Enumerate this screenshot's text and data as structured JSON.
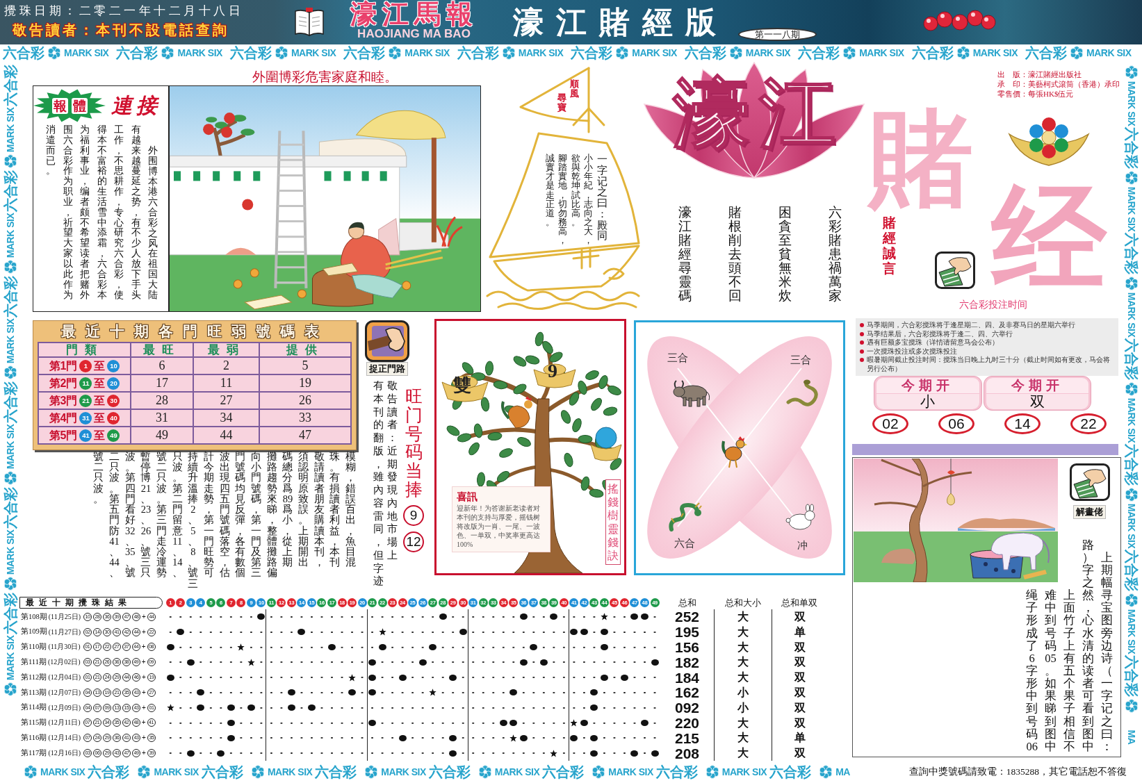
{
  "header": {
    "draw_date": "攪珠日期：二零二一年十二月十八日",
    "notice": "敬告讀者：本刊不設電話查詢",
    "paper_name": "濠江馬報",
    "paper_name_latin": "HAOJIANG MA BAO",
    "edition": "濠江賭經版",
    "issue": "第一一八期"
  },
  "ribbons": {
    "top": [
      {
        "cn": "六合彩",
        "en": "MARK SIX"
      },
      {
        "cn": "六合彩",
        "en": "MARK SIX"
      },
      {
        "cn": "六合彩",
        "en": "MARK SIX"
      },
      {
        "cn": "六合彩",
        "en": "MARK SIX"
      },
      {
        "cn": "六合彩",
        "en": "MARK SIX"
      },
      {
        "cn": "六合彩",
        "en": "MARK SIX"
      },
      {
        "cn": "六合彩",
        "en": "MARK SIX"
      },
      {
        "cn": "六合彩",
        "en": "MARK SIX"
      },
      {
        "cn": "六合彩",
        "en": "MARK SIX"
      },
      {
        "cn": "六合彩",
        "en": "MARK SIX"
      }
    ],
    "left": [
      {
        "cn": "六合彩",
        "en": "MARK SIX"
      },
      {
        "cn": "六合彩",
        "en": "MARK SIX"
      },
      {
        "cn": "六合彩",
        "en": "MARK SIX"
      },
      {
        "cn": "六合彩",
        "en": "MARK SIX"
      },
      {
        "cn": "六合彩",
        "en": "MARK SIX"
      },
      {
        "cn": "六合彩",
        "en": "MARK SIX"
      }
    ],
    "right": [
      {
        "cn": "六合彩",
        "en": "MARK SIX"
      },
      {
        "cn": "六合彩",
        "en": "MARK SIX"
      },
      {
        "cn": "六合彩",
        "en": "MARK SIX"
      },
      {
        "cn": "六合彩",
        "en": "MARK SIX"
      },
      {
        "cn": "六合彩",
        "en": "MARK SIX"
      },
      {
        "cn": "六合彩",
        "en": "MARK SIX"
      },
      {
        "en": "MA"
      }
    ],
    "bottom": [
      {
        "cn": "六合彩",
        "en": "MARK SIX"
      },
      {
        "cn": "六合彩",
        "en": "MARK SIX"
      },
      {
        "cn": "六合彩",
        "en": "MARK SIX"
      },
      {
        "cn": "六合彩",
        "en": "MARK SIX"
      },
      {
        "cn": "六合彩",
        "en": "MARK SIX"
      },
      {
        "cn": "六合彩",
        "en": "MARK SIX"
      },
      {
        "cn": "六合彩",
        "en": "MARK SIX"
      },
      {
        "en": "MA"
      }
    ]
  },
  "headline": "外圍博彩危害家庭和睦。",
  "article": {
    "badge": [
      "報",
      "體"
    ],
    "heading": "連接",
    "columns": [
      "消遣而已。",
      "围六合彩作为职业，祈望大家以此作为",
      "为福利事业，编者颇不希望读者把赌外",
      "得本不富裕的生活雪中添霜，六合彩本",
      "工作，不思耕作，专心研究六合彩，使",
      "有越来越蔓延之势，有不少人放下手头",
      "外围博本港六合彩之风在祖国大陆"
    ]
  },
  "ship": {
    "flag": [
      "尋寶",
      "順風"
    ],
    "sail": [
      "誠實才是走正道。",
      "腳踏實地，切勿務高，",
      "欲與乾坤試比高。",
      "小小年紀，志向之大，",
      "一字记之曰：殿同"
    ]
  },
  "masthead": {
    "publisher": [
      "出　版：濠江賭經出版社",
      "承　印：美藝柯式滾筒（香港）承印",
      "零售價：每張HK$伍元"
    ],
    "logo": [
      "濠江",
      "賭",
      "经"
    ],
    "poems": [
      "濠江賭經尋靈碼",
      "賭根削去頭不回",
      "困貪至貧無米炊",
      "六彩賭患禍萬家"
    ],
    "motto": "賭經誠言",
    "schedule_title": "六合彩投注时间"
  },
  "gate_table": {
    "title": "最近十期各門旺弱號碼表",
    "columns": [
      "門類",
      "最旺",
      "最弱",
      "提供"
    ],
    "rows": [
      {
        "gate": "第1門",
        "from": {
          "number": "1",
          "color": "#e0262f"
        },
        "to_word": "至",
        "to": {
          "number": "10",
          "color": "#1f8fd6"
        },
        "hottest": "6",
        "coldest": "2",
        "tip": "5"
      },
      {
        "gate": "第2門",
        "from": {
          "number": "11",
          "color": "#1e9a4a"
        },
        "to_word": "至",
        "to": {
          "number": "20",
          "color": "#1f8fd6"
        },
        "hottest": "17",
        "coldest": "11",
        "tip": "19"
      },
      {
        "gate": "第3門",
        "from": {
          "number": "21",
          "color": "#1e9a4a"
        },
        "to_word": "至",
        "to": {
          "number": "30",
          "color": "#e0262f"
        },
        "hottest": "28",
        "coldest": "27",
        "tip": "26"
      },
      {
        "gate": "第4門",
        "from": {
          "number": "31",
          "color": "#1f8fd6"
        },
        "to_word": "至",
        "to": {
          "number": "40",
          "color": "#e0262f"
        },
        "hottest": "31",
        "coldest": "34",
        "tip": "33"
      },
      {
        "gate": "第5門",
        "from": {
          "number": "41",
          "color": "#1f8fd6"
        },
        "to_word": "至",
        "to": {
          "number": "49",
          "color": "#1e9a4a"
        },
        "hottest": "49",
        "coldest": "44",
        "tip": "47"
      }
    ]
  },
  "gate_tip": {
    "label": "捉正門路",
    "columns": [
      "號二只波。",
      "二只波。第五門防41、44、",
      "波。第四門看好32、35、號",
      "暫停博21、23、26、號三只",
      "號二只波。第三門走冷運勢",
      "只波。第二門留意11、14、",
      "持續升溫捧2、5、8、號三",
      "計今期走勢，第一門旺勢可",
      "波出現四五門號碼落空，估",
      "門號碼均見反彈，各有數個",
      "向小門號碼，第一門及第三",
      "攤路趨勢來睇，整體攤路偏",
      "碼總分爲89爲小，從上期",
      "須認明原致誤。上期開出",
      "敬請讀者朋友購讀本刊，",
      "珠。有損讀者利益，本刊",
      "模糊，錯誤百出，魚目混",
      "有本刊的翻版，雖內容雷同，但字迹",
      "敬告讀者：近期發現內地市場上"
    ],
    "hot_title": "旺门号码当捧",
    "hot_numbers": [
      "9",
      "12"
    ]
  },
  "money_tree": {
    "tags": [
      "雙",
      "9"
    ],
    "notice_title": "喜訊",
    "notice": "迎新年！为答谢新老读者对本刊的支持与厚爱，摇钱树将改版为一肖、一尾、一波色、一单双，中奖率更高达100%",
    "caption": "搖錢樹靈錢訣"
  },
  "zodiac": {
    "labels": [
      "三合",
      "三合",
      "六合",
      "冲"
    ]
  },
  "schedule": [
    "马季期间，六合彩搅珠将于逢星期二、四、及非赛马日的星期六举行",
    "马季结果后，六合彩搅珠将于逢二、四、六举行",
    "遇有巨额多宝搅珠（详情请留意马会公布）",
    "一次搅珠投注或多次搅珠投注",
    "暇暑期间截止投注时间：搅珠当日晚上九时三十分（截止时间如有更改，马会将另行公布）"
  ],
  "this_draw": {
    "cards": [
      {
        "title": "今期开",
        "value": "小"
      },
      {
        "title": "今期开",
        "value": "双"
      }
    ],
    "numbers": [
      "02",
      "06",
      "14",
      "22"
    ]
  },
  "riddle": {
    "label": "解畫佬",
    "columns": [
      "绳子形成了6字形中到号码06",
      "难中到号码05。如果睇到图中",
      "上面竹子上有五个果子相信不",
      "路）字之然，心水清的读者可看到图中",
      "上期幅寻宝图旁边诗（一字记之曰："
    ]
  },
  "results": {
    "title": "最近十期攪珠結果",
    "balls": [
      {
        "number": "1",
        "color": "#e0262f"
      },
      {
        "number": "2",
        "color": "#e0262f"
      },
      {
        "number": "3",
        "color": "#1f8fd6"
      },
      {
        "number": "4",
        "color": "#1f8fd6"
      },
      {
        "number": "5",
        "color": "#1e9a4a"
      },
      {
        "number": "6",
        "color": "#1e9a4a"
      },
      {
        "number": "7",
        "color": "#e0262f"
      },
      {
        "number": "8",
        "color": "#e0262f"
      },
      {
        "number": "9",
        "color": "#1f8fd6"
      },
      {
        "number": "10",
        "color": "#1f8fd6"
      },
      {
        "number": "11",
        "color": "#1e9a4a"
      },
      {
        "number": "12",
        "color": "#e0262f"
      },
      {
        "number": "13",
        "color": "#e0262f"
      },
      {
        "number": "14",
        "color": "#1f8fd6"
      },
      {
        "number": "15",
        "color": "#1f8fd6"
      },
      {
        "number": "16",
        "color": "#1e9a4a"
      },
      {
        "number": "17",
        "color": "#1e9a4a"
      },
      {
        "number": "18",
        "color": "#e0262f"
      },
      {
        "number": "19",
        "color": "#e0262f"
      },
      {
        "number": "20",
        "color": "#1f8fd6"
      },
      {
        "number": "21",
        "color": "#1e9a4a"
      },
      {
        "number": "22",
        "color": "#1e9a4a"
      },
      {
        "number": "23",
        "color": "#e0262f"
      },
      {
        "number": "24",
        "color": "#e0262f"
      },
      {
        "number": "25",
        "color": "#1f8fd6"
      },
      {
        "number": "26",
        "color": "#1f8fd6"
      },
      {
        "number": "27",
        "color": "#1e9a4a"
      },
      {
        "number": "28",
        "color": "#1e9a4a"
      },
      {
        "number": "29",
        "color": "#e0262f"
      },
      {
        "number": "30",
        "color": "#e0262f"
      },
      {
        "number": "31",
        "color": "#1f8fd6"
      },
      {
        "number": "32",
        "color": "#1e9a4a"
      },
      {
        "number": "33",
        "color": "#1e9a4a"
      },
      {
        "number": "34",
        "color": "#e0262f"
      },
      {
        "number": "35",
        "color": "#e0262f"
      },
      {
        "number": "36",
        "color": "#1f8fd6"
      },
      {
        "number": "37",
        "color": "#1f8fd6"
      },
      {
        "number": "38",
        "color": "#1e9a4a"
      },
      {
        "number": "39",
        "color": "#1e9a4a"
      },
      {
        "number": "40",
        "color": "#e0262f"
      },
      {
        "number": "41",
        "color": "#1f8fd6"
      },
      {
        "number": "42",
        "color": "#1f8fd6"
      },
      {
        "number": "43",
        "color": "#1e9a4a"
      },
      {
        "number": "44",
        "color": "#1e9a4a"
      },
      {
        "number": "45",
        "color": "#e0262f"
      },
      {
        "number": "46",
        "color": "#e0262f"
      },
      {
        "number": "47",
        "color": "#1f8fd6"
      },
      {
        "number": "48",
        "color": "#1f8fd6"
      },
      {
        "number": "49",
        "color": "#1e9a4a"
      }
    ],
    "columns": [
      "总和",
      "总和大小",
      "总和单双"
    ],
    "rows": [
      {
        "issue": "第108期",
        "date": "(11月25日)",
        "numbers": [
          "10",
          "28",
          "36",
          "39",
          "47",
          "48"
        ],
        "plus": "+",
        "special": "44",
        "sum": "252",
        "size": "大",
        "parity": "双"
      },
      {
        "issue": "第109期",
        "date": "(11月27日)",
        "numbers": [
          "02",
          "14",
          "30",
          "41",
          "42",
          "44"
        ],
        "plus": "+",
        "special": "22",
        "sum": "195",
        "size": "大",
        "parity": "单"
      },
      {
        "issue": "第110期",
        "date": "(11月30日)",
        "numbers": [
          "01",
          "17",
          "22",
          "27",
          "37",
          "44"
        ],
        "plus": "+",
        "special": "08",
        "sum": "156",
        "size": "大",
        "parity": "双"
      },
      {
        "issue": "第111期",
        "date": "(12月02日)",
        "numbers": [
          "03",
          "21",
          "26",
          "36",
          "38",
          "49"
        ],
        "plus": "+",
        "special": "09",
        "sum": "182",
        "size": "大",
        "parity": "双"
      },
      {
        "issue": "第112期",
        "date": "(12月04日)",
        "numbers": [
          "01",
          "21",
          "24",
          "29",
          "44",
          "46"
        ],
        "plus": "+",
        "special": "19",
        "sum": "184",
        "size": "大",
        "parity": "双"
      },
      {
        "issue": "第113期",
        "date": "(12月07日)",
        "numbers": [
          "04",
          "13",
          "19",
          "21",
          "35",
          "43"
        ],
        "plus": "+",
        "special": "27",
        "sum": "162",
        "size": "小",
        "parity": "双"
      },
      {
        "issue": "第114期",
        "date": "(12月09日)",
        "numbers": [
          "04",
          "07",
          "09",
          "13",
          "15",
          "43"
        ],
        "plus": "+",
        "special": "01",
        "sum": "092",
        "size": "小",
        "parity": "双"
      },
      {
        "issue": "第115期",
        "date": "(12月11日)",
        "numbers": [
          "07",
          "21",
          "34",
          "35",
          "42",
          "48"
        ],
        "plus": "+",
        "special": "41",
        "sum": "220",
        "size": "大",
        "parity": "双"
      },
      {
        "issue": "第116期",
        "date": "(12月14日)",
        "numbers": [
          "07",
          "24",
          "29",
          "36",
          "41",
          "43"
        ],
        "plus": "+",
        "special": "35",
        "sum": "215",
        "size": "大",
        "parity": "单"
      },
      {
        "issue": "第117期",
        "date": "(12月16日)",
        "numbers": [
          "03",
          "06",
          "29",
          "43",
          "47",
          "49"
        ],
        "plus": "+",
        "special": "39",
        "sum": "208",
        "size": "大",
        "parity": "双"
      }
    ]
  },
  "hotline": "查詢中獎號碼請致電：1835288，其它電話恕不答復"
}
